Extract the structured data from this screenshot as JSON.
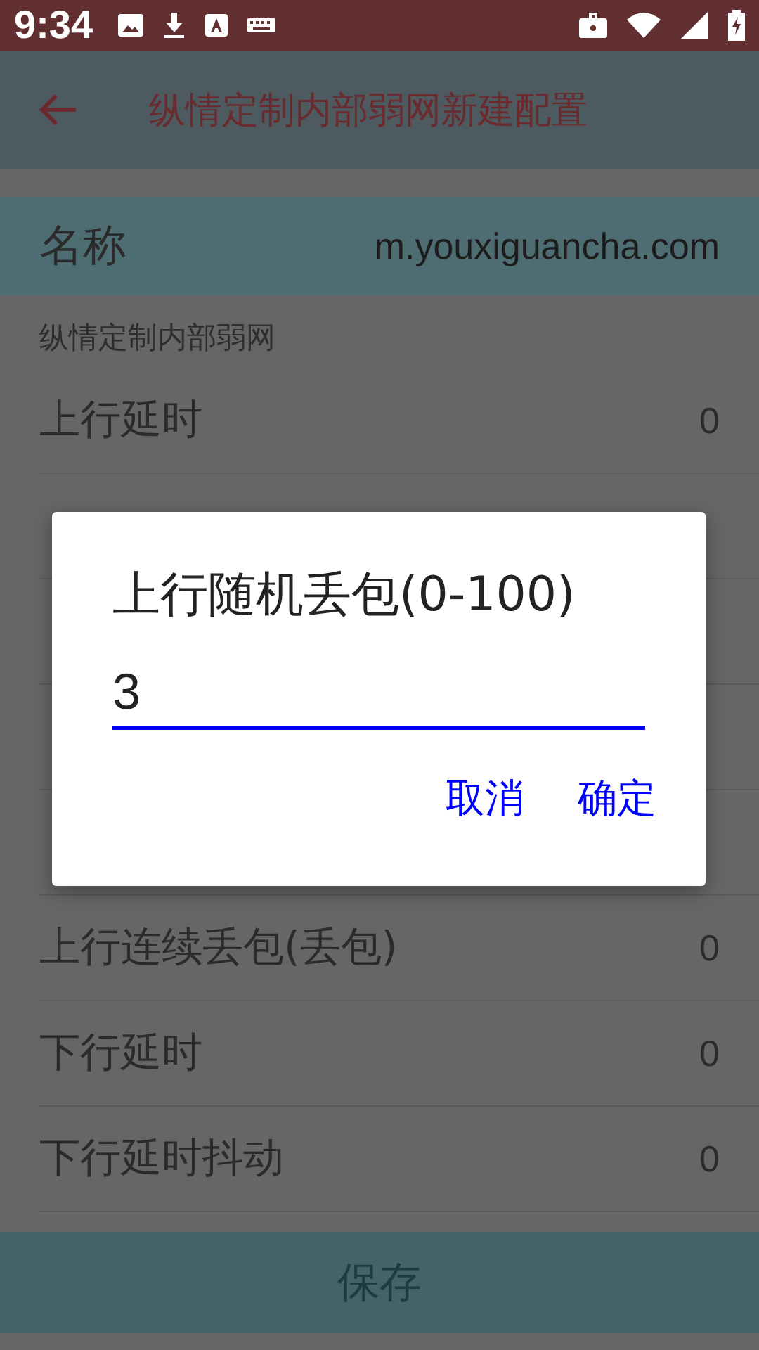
{
  "status_bar": {
    "time": "9:34"
  },
  "app_bar": {
    "title": "纵情定制内部弱网新建配置"
  },
  "name_row": {
    "label": "名称",
    "value": "m.youxiguancha.com"
  },
  "section": {
    "label": "纵情定制内部弱网"
  },
  "rows": [
    {
      "kind": "setting",
      "label": "上行延时",
      "value": "0"
    },
    {
      "kind": "covered"
    },
    {
      "kind": "covered"
    },
    {
      "kind": "covered"
    },
    {
      "kind": "covered"
    },
    {
      "kind": "setting",
      "label": "上行连续丢包(丢包)",
      "value": "0"
    },
    {
      "kind": "setting",
      "label": "下行延时",
      "value": "0"
    },
    {
      "kind": "setting",
      "label": "下行延时抖动",
      "value": "0"
    }
  ],
  "save_button": {
    "label": "保存"
  },
  "dialog": {
    "title": "上行随机丢包(0-100)",
    "value": "3",
    "buttons": [
      "取消",
      "确定"
    ]
  }
}
